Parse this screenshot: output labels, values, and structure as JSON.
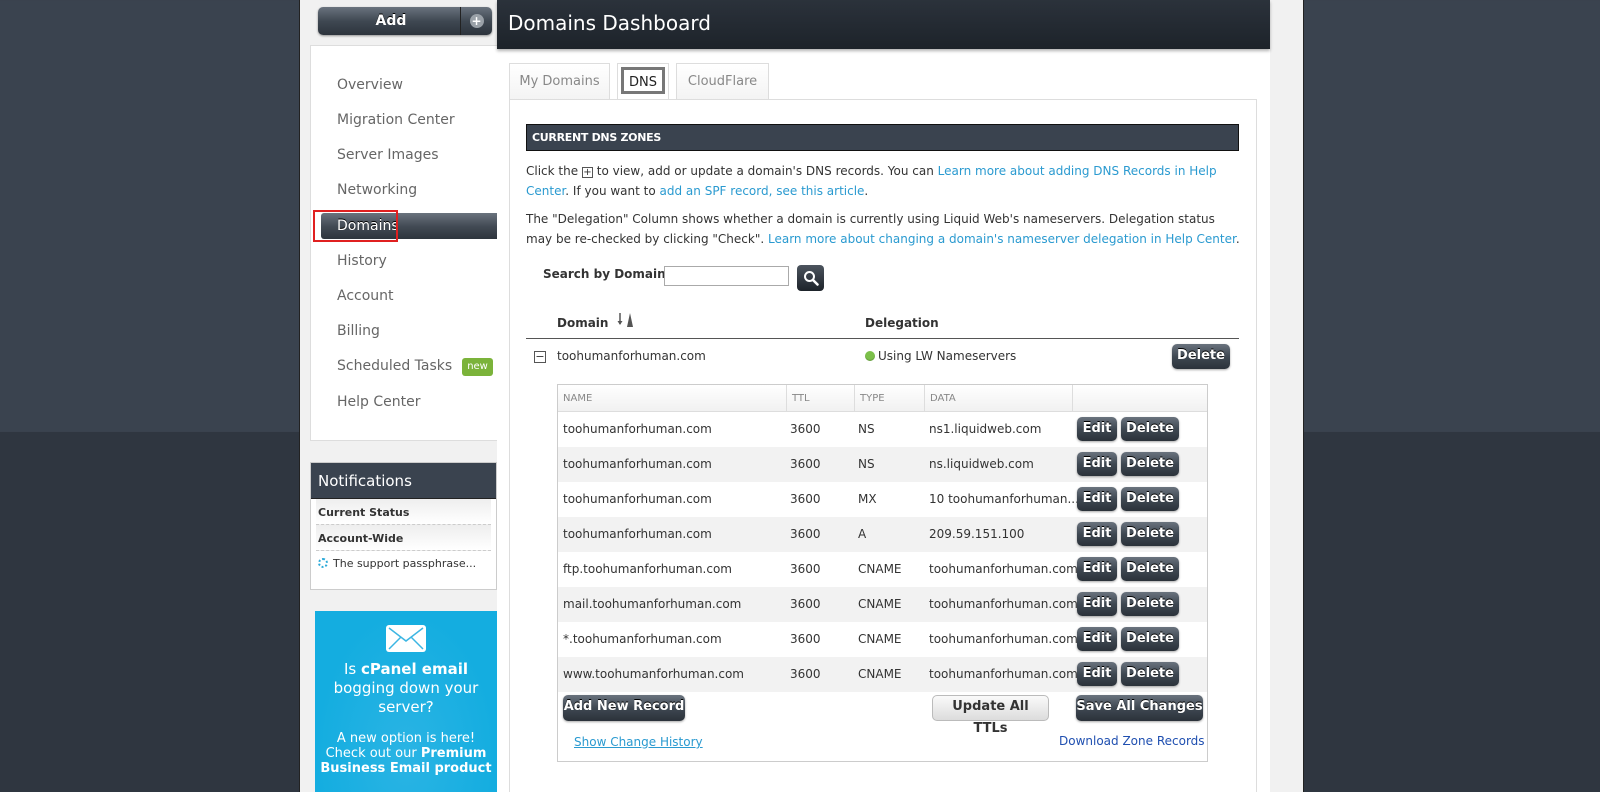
{
  "sidebar": {
    "add_button": "Add",
    "add_plus": "+",
    "nav": [
      {
        "label": "Overview",
        "active": false
      },
      {
        "label": "Migration Center",
        "active": false
      },
      {
        "label": "Server Images",
        "active": false
      },
      {
        "label": "Networking",
        "active": false
      },
      {
        "label": "Domains",
        "active": true
      },
      {
        "label": "History",
        "active": false
      },
      {
        "label": "Account",
        "active": false
      },
      {
        "label": "Billing",
        "active": false
      },
      {
        "label": "Scheduled Tasks",
        "active": false,
        "badge": "new"
      },
      {
        "label": "Help Center",
        "active": false
      }
    ],
    "notifications": {
      "title": "Notifications",
      "current_status": "Current Status",
      "account_wide": "Account-Wide",
      "item": "The support passphrase..."
    },
    "promo": {
      "line1_pre": "Is ",
      "line1_bold": "cPanel email",
      "line2": "bogging down your",
      "line3": "server?",
      "sub1": "A new option is here!",
      "sub2_pre": "Check out our ",
      "sub2_bold": "Premium",
      "sub3_bold": "Business Email product"
    }
  },
  "header": {
    "title": "Domains Dashboard"
  },
  "tabs": [
    {
      "label": "My Domains",
      "active": false
    },
    {
      "label": "DNS",
      "active": true
    },
    {
      "label": "CloudFlare",
      "active": false
    }
  ],
  "dns": {
    "section_title": "CURRENT DNS ZONES",
    "para1": {
      "t1": "Click the ",
      "icon": "+",
      "t2": " to view, add or update a domain's DNS records. You can ",
      "link1": "Learn more about adding DNS Records in Help Center",
      "t3": ". If you want to ",
      "link2": "add an SPF record, see this article",
      "t4": "."
    },
    "para2": {
      "t1": "The \"Delegation\" Column shows whether a domain is currently using Liquid Web's nameservers. Delegation status may be re-checked by clicking \"Check\". ",
      "link": "Learn more about changing a domain's nameserver delegation in Help Center",
      "t2": "."
    },
    "search": {
      "label": "Search by Domain:",
      "value": "",
      "placeholder": ""
    },
    "columns": {
      "domain": "Domain",
      "delegation": "Delegation"
    },
    "domain": {
      "name": "toohumanforhuman.com",
      "toggle": "−",
      "delegation_status": "Using LW Nameservers",
      "delegation_color": "#7cc04a",
      "delete_label": "Delete"
    },
    "records": {
      "headers": [
        "NAME",
        "TTL",
        "TYPE",
        "DATA"
      ],
      "rows": [
        {
          "name": "toohumanforhuman.com",
          "ttl": "3600",
          "type": "NS",
          "data": "ns1.liquidweb.com"
        },
        {
          "name": "toohumanforhuman.com",
          "ttl": "3600",
          "type": "NS",
          "data": "ns.liquidweb.com"
        },
        {
          "name": "toohumanforhuman.com",
          "ttl": "3600",
          "type": "MX",
          "data": "10 toohumanforhuman..."
        },
        {
          "name": "toohumanforhuman.com",
          "ttl": "3600",
          "type": "A",
          "data": "209.59.151.100"
        },
        {
          "name": "ftp.toohumanforhuman.com",
          "ttl": "3600",
          "type": "CNAME",
          "data": "toohumanforhuman.com"
        },
        {
          "name": "mail.toohumanforhuman.com",
          "ttl": "3600",
          "type": "CNAME",
          "data": "toohumanforhuman.com"
        },
        {
          "name": "*.toohumanforhuman.com",
          "ttl": "3600",
          "type": "CNAME",
          "data": "toohumanforhuman.com"
        },
        {
          "name": "www.toohumanforhuman.com",
          "ttl": "3600",
          "type": "CNAME",
          "data": "toohumanforhuman.com"
        }
      ],
      "edit_label": "Edit",
      "delete_label": "Delete",
      "add_new_record": "Add New Record",
      "update_all_ttls": "Update All TTLs",
      "save_all_changes": "Save All Changes",
      "show_change_history": "Show Change History",
      "download_zone_records": "Download Zone Records"
    }
  }
}
